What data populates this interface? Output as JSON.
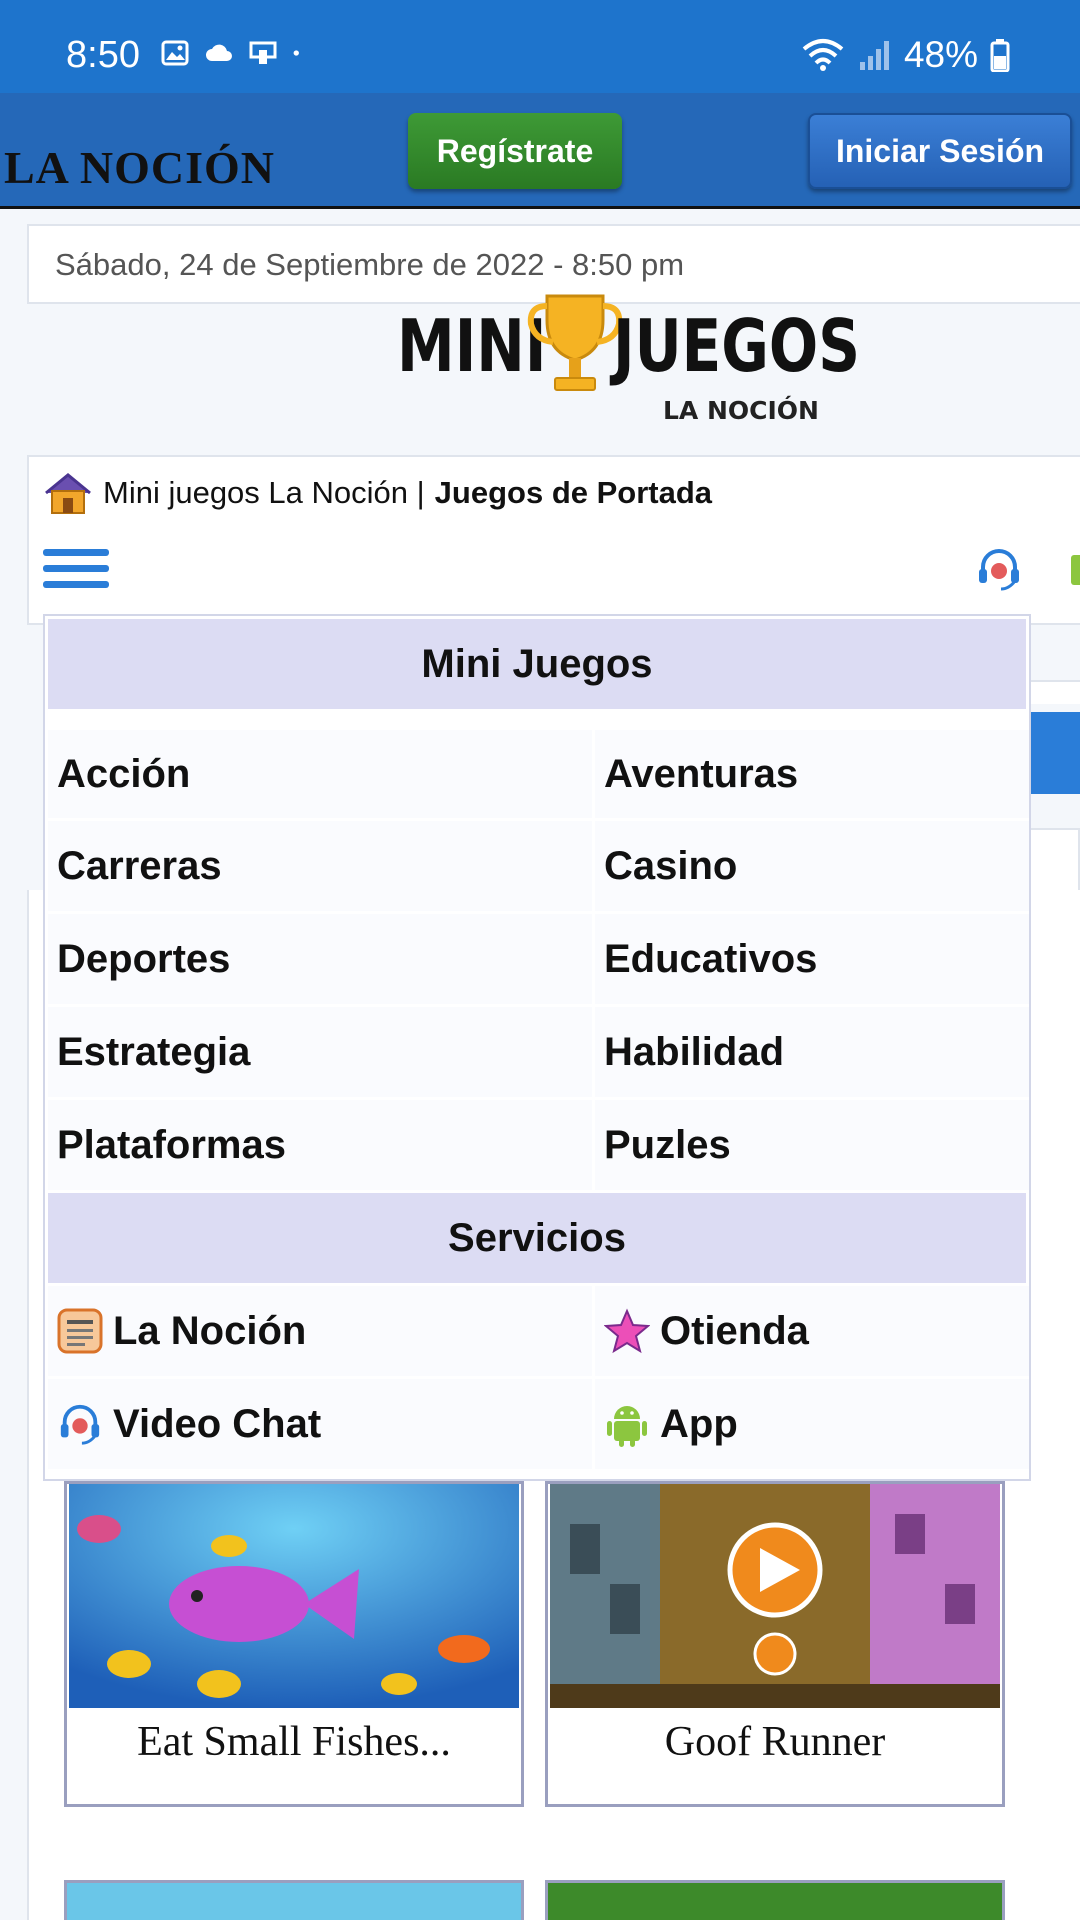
{
  "status_bar": {
    "time": "8:50",
    "battery": "48%"
  },
  "header": {
    "logo_text": "LA NOCIÓN",
    "register_label": "Regístrate",
    "login_label": "Iniciar Sesión"
  },
  "date_bar": {
    "text": "Sábado, 24 de Septiembre de 2022 - 8:50 pm"
  },
  "site_logo": {
    "word_left": "MINI",
    "word_right": "JUEGOS",
    "subtitle": "LA NOCIÓN"
  },
  "breadcrumb": {
    "prefix": "Mini juegos La Noción |",
    "current": "Juegos de Portada"
  },
  "menu": {
    "header_games": "Mini Juegos",
    "categories": [
      {
        "label": "Acción"
      },
      {
        "label": "Aventuras"
      },
      {
        "label": "Carreras"
      },
      {
        "label": "Casino"
      },
      {
        "label": "Deportes"
      },
      {
        "label": "Educativos"
      },
      {
        "label": "Estrategia"
      },
      {
        "label": "Habilidad"
      },
      {
        "label": "Plataformas"
      },
      {
        "label": "Puzles"
      }
    ],
    "header_services": "Servicios",
    "services": [
      {
        "label": "La Noción",
        "icon": "newspaper-icon"
      },
      {
        "label": "Otienda",
        "icon": "star-icon"
      },
      {
        "label": "Video Chat",
        "icon": "headset-icon"
      },
      {
        "label": "App",
        "icon": "android-icon"
      }
    ]
  },
  "games": [
    {
      "title": "Eat Small Fishes..."
    },
    {
      "title": "Goof Runner"
    }
  ],
  "colors": {
    "status_bar": "#1e74cc",
    "header": "#2568b8",
    "register_button": "#2f8a28",
    "login_button": "#2c6fc9",
    "menu_header": "#dcdcf3"
  }
}
